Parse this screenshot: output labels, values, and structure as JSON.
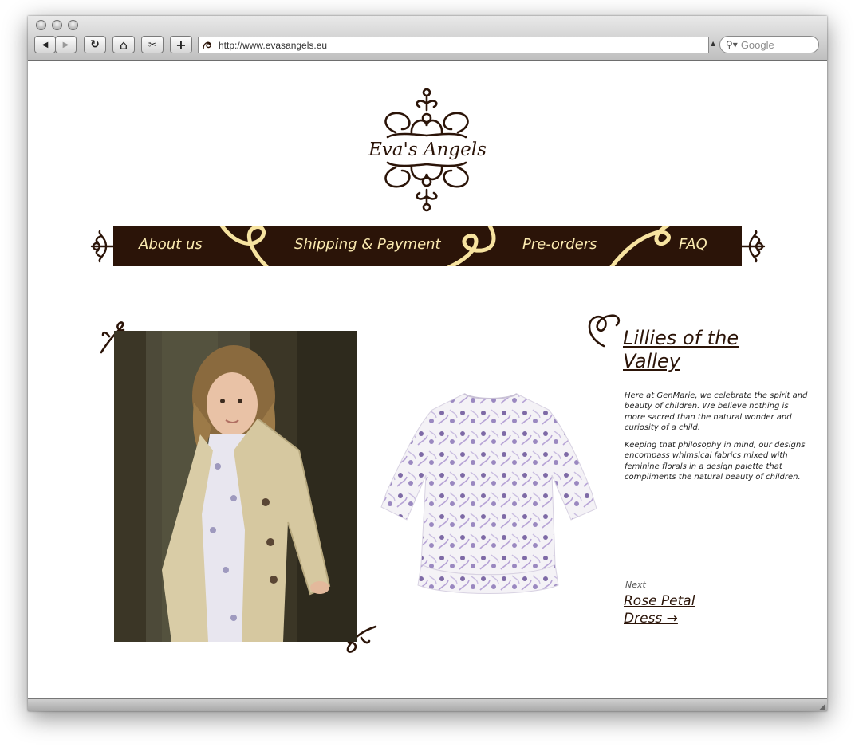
{
  "browser": {
    "url": "http://www.evasangels.eu",
    "search_placeholder": "Google",
    "buttons": {
      "back_icon": "◀",
      "forward_icon": "▶",
      "reload_icon": "↻",
      "home_icon": "⌂",
      "clip_icon": "✂",
      "add_icon": "+"
    }
  },
  "site": {
    "logo_text": "Eva's Angels",
    "nav": {
      "about": "About us",
      "shipping": "Shipping & Payment",
      "preorders": "Pre-orders",
      "faq": "FAQ"
    },
    "product": {
      "title": "Lillies of the Valley",
      "paragraph1": "Here at GenMarie, we celebrate the spirit and beauty of children. We believe nothing is more sacred than the natural wonder and curiosity of a child.",
      "paragraph2": "Keeping that philosophy in mind, our designs encompass whimsical fabrics mixed with feminine florals in a design palette that compliments the natural beauty of children.",
      "next_label": "Next",
      "next_link": "Rose Petal Dress →"
    }
  },
  "colors": {
    "brand_brown": "#2b1408",
    "nav_text": "#fbeab0"
  }
}
